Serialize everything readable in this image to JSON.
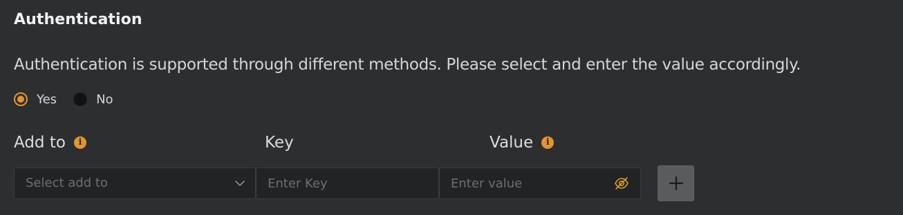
{
  "section": {
    "title": "Authentication",
    "description": "Authentication is supported through different methods. Please select and enter the value accordingly."
  },
  "radio": {
    "selected": "Yes",
    "options": [
      {
        "label": "Yes",
        "checked": true
      },
      {
        "label": "No",
        "checked": false
      }
    ]
  },
  "fields": {
    "add_to": {
      "label": "Add to",
      "placeholder": "Select add to",
      "has_info": true
    },
    "key": {
      "label": "Key",
      "placeholder": "Enter Key"
    },
    "value": {
      "label": "Value",
      "placeholder": "Enter value",
      "has_info": true
    }
  },
  "icons": {
    "info": "info-icon",
    "chevron": "chevron-down-icon",
    "visibility": "eye-off-icon",
    "add": "plus-icon",
    "info_glyph": "i"
  },
  "colors": {
    "background": "#2d2e30",
    "accent": "#e3952f",
    "input_bg": "#222325",
    "button_bg": "#5a5b5e"
  }
}
